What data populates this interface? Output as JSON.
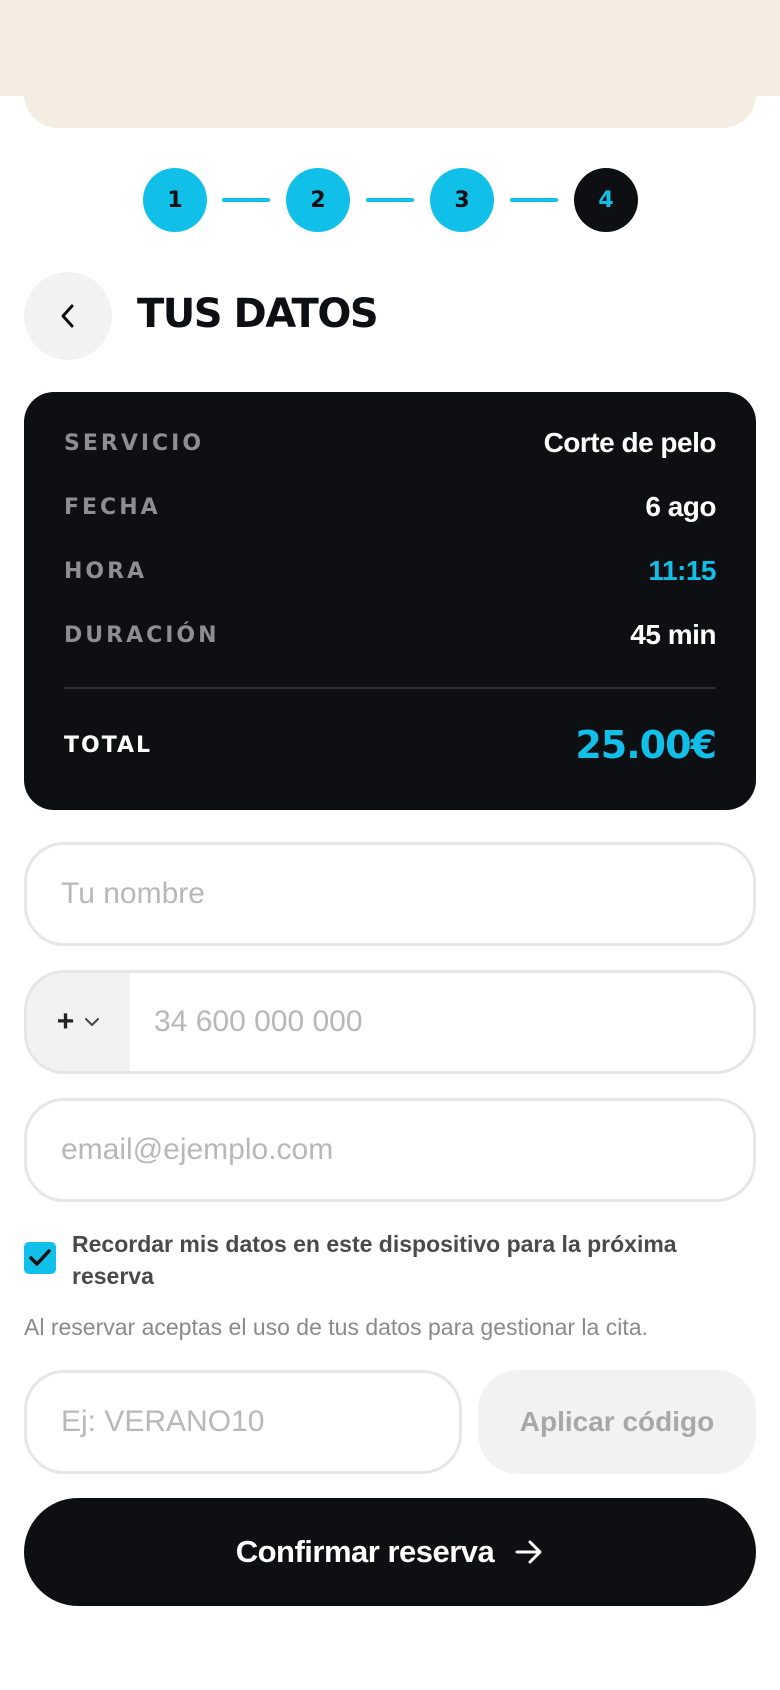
{
  "stepper": {
    "steps": [
      {
        "label": "1",
        "state": "done"
      },
      {
        "label": "2",
        "state": "done"
      },
      {
        "label": "3",
        "state": "done"
      },
      {
        "label": "4",
        "state": "active"
      }
    ]
  },
  "header": {
    "title": "TUS DATOS",
    "back_icon": "chevron-left-icon"
  },
  "summary": {
    "rows": [
      {
        "label": "SERVICIO",
        "value": "Corte de pelo"
      },
      {
        "label": "FECHA",
        "value": "6 ago"
      },
      {
        "label": "HORA",
        "value": "11:15"
      },
      {
        "label": "DURACIÓN",
        "value": "45 min"
      }
    ],
    "total_label": "TOTAL",
    "total_value": "25.00€"
  },
  "form": {
    "name_placeholder": "Tu nombre",
    "country_prefix": "+",
    "phone_placeholder": "34 600 000 000",
    "email_placeholder": "email@ejemplo.com",
    "remember_checked": true,
    "remember_label": "Recordar mis datos en este dispositivo para la próxima reserva",
    "legal_text": "Al reservar aceptas el uso de tus datos para gestionar la cita.",
    "promo_placeholder": "Ej: VERANO10",
    "apply_label": "Aplicar código",
    "confirm_label": "Confirmar reserva"
  },
  "colors": {
    "accent": "#10c0e8",
    "dark": "#0d0f12",
    "cream": "#f3ede2"
  }
}
